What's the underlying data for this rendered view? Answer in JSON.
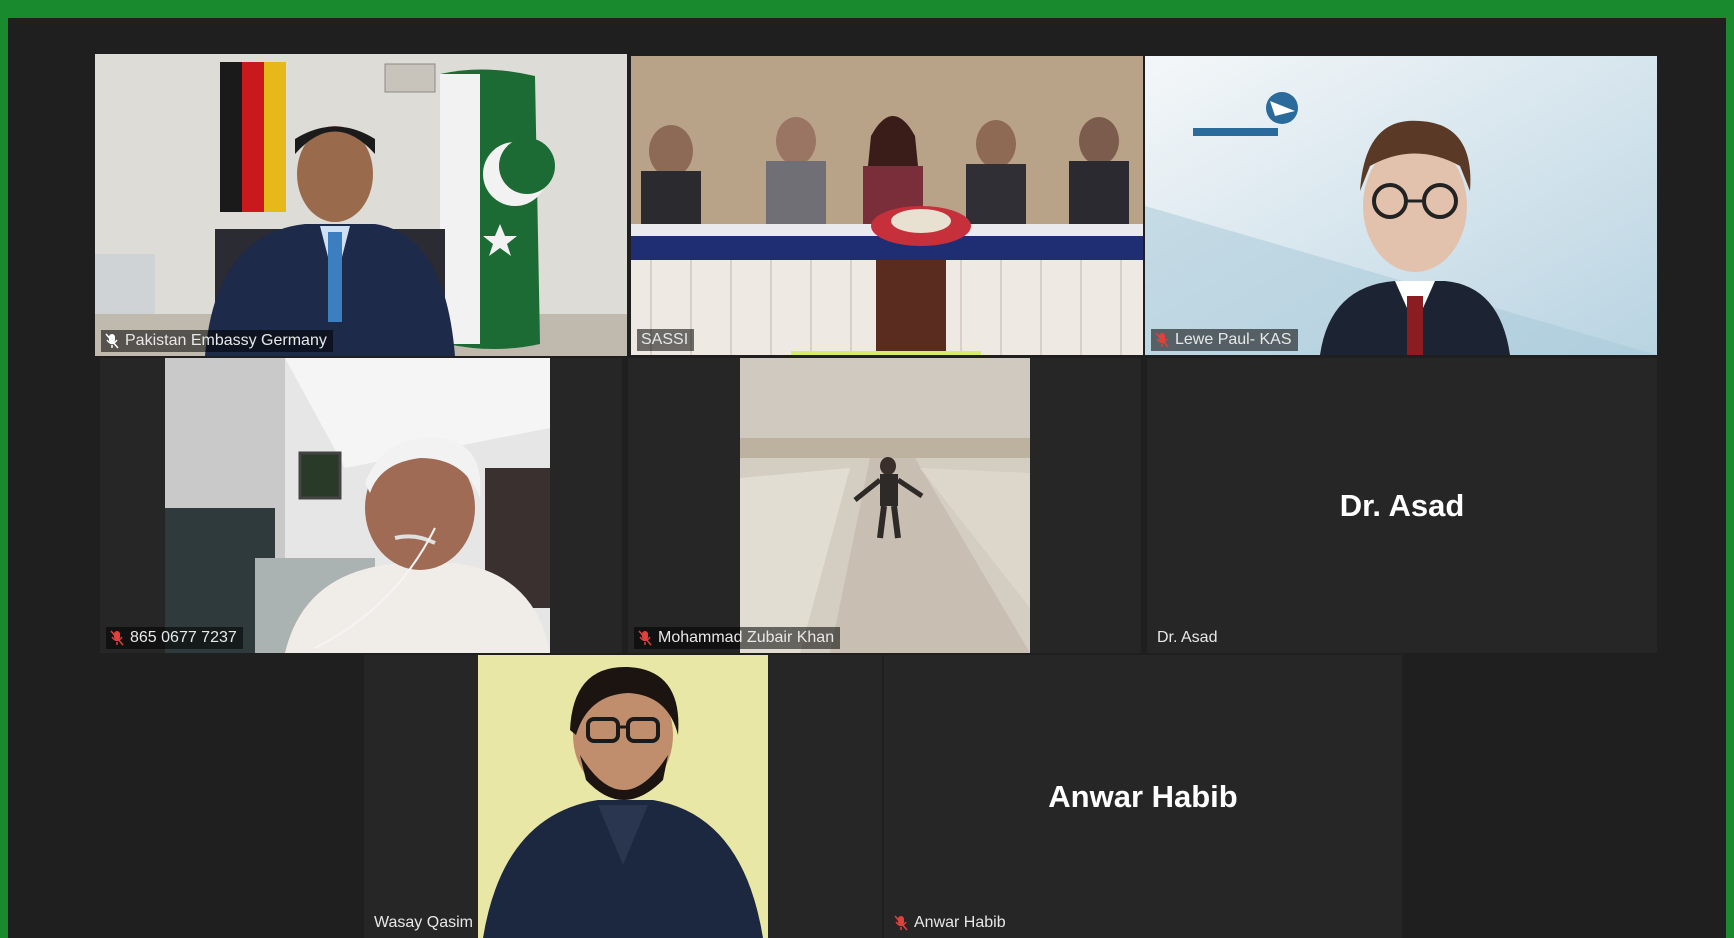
{
  "participants": {
    "p1": {
      "name": "Pakistan Embassy Germany",
      "muted": true
    },
    "p2": {
      "name": "SASSI",
      "muted": false
    },
    "p3": {
      "name": "Lewe Paul- KAS",
      "muted": true
    },
    "p4": {
      "name": "865 0677 7237",
      "muted": true
    },
    "p5": {
      "name": "Mohammad Zubair Khan",
      "muted": true
    },
    "p6": {
      "name": "Dr. Asad",
      "display": "Dr. Asad",
      "muted": false
    },
    "p7": {
      "name": "Wasay Qasim",
      "muted": false
    },
    "p8": {
      "name": "Anwar Habib",
      "display": "Anwar Habib",
      "muted": true
    }
  },
  "colors": {
    "accent": "#1a8a2e",
    "active_speaker": "#d6ec6a",
    "muted_icon": "#e0413c"
  }
}
